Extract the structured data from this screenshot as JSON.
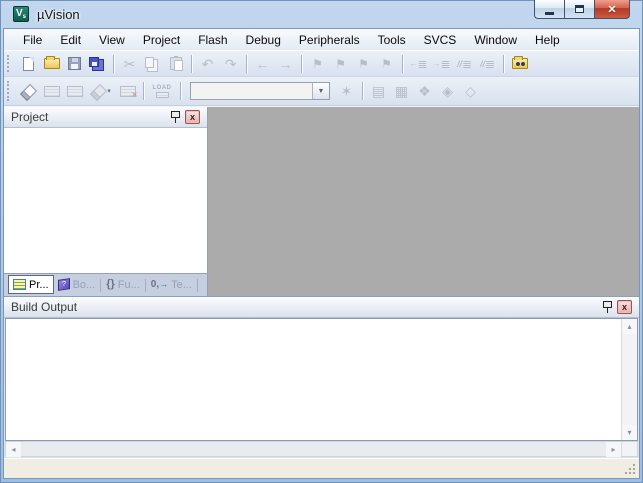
{
  "window": {
    "title": "µVision"
  },
  "menu": {
    "items": [
      "File",
      "Edit",
      "View",
      "Project",
      "Flash",
      "Debug",
      "Peripherals",
      "Tools",
      "SVCS",
      "Window",
      "Help"
    ]
  },
  "toolbar_build": {
    "load_label": "LOAD",
    "target_value": ""
  },
  "project_panel": {
    "title": "Project",
    "tabs": [
      {
        "label": "Pr..."
      },
      {
        "label": "Bo..."
      },
      {
        "label": "Fu..."
      },
      {
        "label": "Te..."
      }
    ]
  },
  "build_output": {
    "title": "Build Output",
    "content": ""
  },
  "status_bar": {
    "text": ""
  },
  "icons": {
    "cut": "✂",
    "undo": "↶",
    "redo": "↷",
    "back": "←",
    "forward": "→",
    "bookmark": "⚑",
    "lines": "≣",
    "arrow_right": "→",
    "arrow_left": "←",
    "slashes": "//",
    "dropdown": "▾",
    "combo_dropdown": "▼",
    "wand": "✶",
    "stamp": "▤",
    "cascade": "▦",
    "pack": "❖",
    "filter": "◈",
    "runtime": "◇",
    "stop_x": "✕",
    "functions": "{}",
    "template_zero": "0,",
    "template_arrow": "→",
    "book_q": "?",
    "close_x": "x",
    "win_close": "✕",
    "scroll_up": "▴",
    "scroll_down": "▾",
    "scroll_left": "◂",
    "scroll_right": "▸"
  },
  "colors": {
    "frame_blue": "#a6c1e0",
    "workspace_gray": "#ababab",
    "toolbar_bg": "#dde5f1",
    "statusbar_bg": "#f0ede5",
    "close_red": "#c0503c",
    "logo_green": "#0c5c4c",
    "tab_active_bg": "#ffffff",
    "panel_header_top": "#fbfcfe"
  }
}
